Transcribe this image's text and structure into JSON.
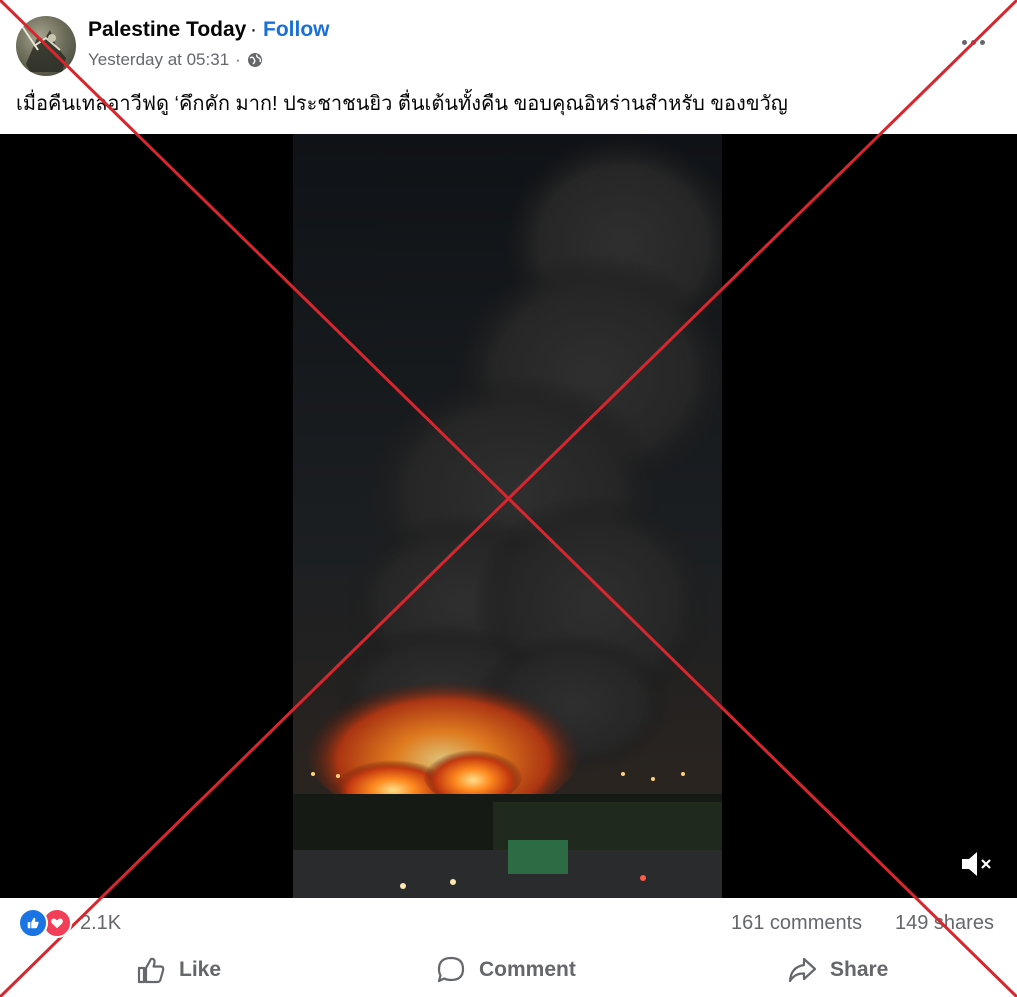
{
  "post": {
    "page_name": "Palestine Today",
    "separator": "·",
    "follow_label": "Follow",
    "timestamp": "Yesterday at 05:31",
    "meta_separator": "·",
    "audience_icon": "globe-icon",
    "more_icon": "more-options-icon",
    "caption": "เมื่อคืนเทลอาวีฟดู ‘คึกคัก มาก! ประชาชนยิว ตื่นเต้นทั้งคืน  ขอบคุณอิหร่านสำหรับ ของขวัญ"
  },
  "video": {
    "mute_icon": "speaker-muted-icon"
  },
  "stats": {
    "reactions": [
      "like",
      "love"
    ],
    "reaction_count": "2.1K",
    "comments": "161 comments",
    "shares": "149 shares"
  },
  "actions": {
    "like": "Like",
    "comment": "Comment",
    "share": "Share"
  },
  "overlay": {
    "cross_color": "#d7262e"
  }
}
